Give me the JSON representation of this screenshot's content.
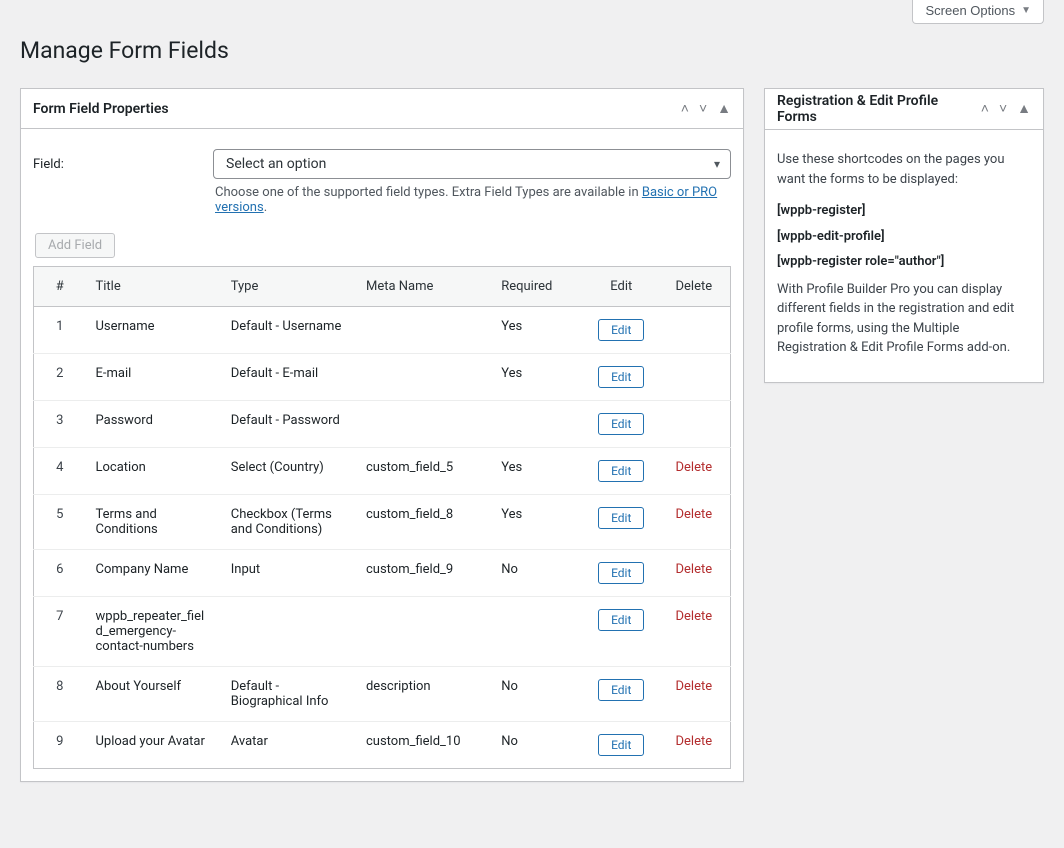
{
  "screen_options_label": "Screen Options",
  "page_title": "Manage Form Fields",
  "main_panel": {
    "title": "Form Field Properties",
    "field_label": "Field:",
    "select_placeholder": "Select an option",
    "desc_before_link": "Choose one of the supported field types. Extra Field Types are available in ",
    "desc_link_text": "Basic or PRO versions",
    "desc_after_link": ".",
    "add_button": "Add Field",
    "columns": {
      "num": "#",
      "title": "Title",
      "type": "Type",
      "meta": "Meta Name",
      "required": "Required",
      "edit": "Edit",
      "delete": "Delete"
    },
    "edit_label": "Edit",
    "delete_label": "Delete",
    "rows": [
      {
        "n": "1",
        "title": "Username",
        "type": "Default - Username",
        "meta": "",
        "required": "Yes",
        "deletable": false
      },
      {
        "n": "2",
        "title": "E-mail",
        "type": "Default - E-mail",
        "meta": "",
        "required": "Yes",
        "deletable": false
      },
      {
        "n": "3",
        "title": "Password",
        "type": "Default - Password",
        "meta": "",
        "required": "",
        "deletable": false
      },
      {
        "n": "4",
        "title": "Location",
        "type": "Select (Country)",
        "meta": "custom_field_5",
        "required": "Yes",
        "deletable": true
      },
      {
        "n": "5",
        "title": "Terms and Conditions",
        "type": "Checkbox (Terms and Conditions)",
        "meta": "custom_field_8",
        "required": "Yes",
        "deletable": true
      },
      {
        "n": "6",
        "title": "Company Name",
        "type": "Input",
        "meta": "custom_field_9",
        "required": "No",
        "deletable": true
      },
      {
        "n": "7",
        "title": "wppb_repeater_field_emergency-contact-numbers",
        "type": "",
        "meta": "",
        "required": "",
        "deletable": true
      },
      {
        "n": "8",
        "title": "About Yourself",
        "type": "Default - Biographical Info",
        "meta": "description",
        "required": "No",
        "deletable": true
      },
      {
        "n": "9",
        "title": "Upload your Avatar",
        "type": "Avatar",
        "meta": "custom_field_10",
        "required": "No",
        "deletable": true
      }
    ]
  },
  "side_panel": {
    "title": "Registration & Edit Profile Forms",
    "intro": "Use these shortcodes on the pages you want the forms to be displayed:",
    "shortcodes": [
      "[wppb-register]",
      "[wppb-edit-profile]",
      "[wppb-register role=\"author\"]"
    ],
    "outro": "With Profile Builder Pro you can display different fields in the registration and edit profile forms, using the Multiple Registration & Edit Profile Forms add-on."
  }
}
